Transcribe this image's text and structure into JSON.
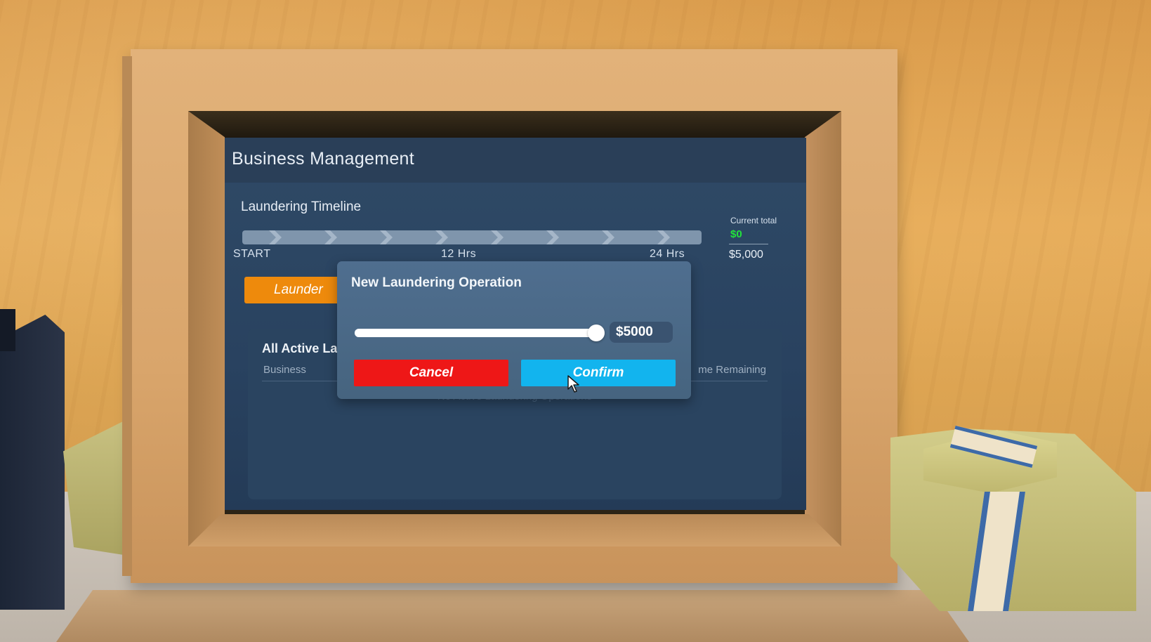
{
  "screen": {
    "title": "Business Management",
    "timeline": {
      "title": "Laundering Timeline",
      "start_label": "START",
      "mid_label": "12 Hrs",
      "end_label": "24 Hrs"
    },
    "current_total": {
      "label": "Current total",
      "value": "$0",
      "max": "$5,000"
    },
    "launder_button": "Launder",
    "active_panel": {
      "title": "All Active Lau",
      "col_business": "Business",
      "col_time": "me Remaining",
      "empty_message": "No Active Laundering Operations"
    }
  },
  "modal": {
    "title": "New Laundering Operation",
    "slider": {
      "fraction": 1.0
    },
    "amount": "$5000",
    "cancel_label": "Cancel",
    "confirm_label": "Confirm"
  },
  "colors": {
    "accent_orange": "#ee8a0c",
    "cancel_red": "#ee1717",
    "confirm_blue": "#12b4ee",
    "money_green": "#22e23c"
  }
}
